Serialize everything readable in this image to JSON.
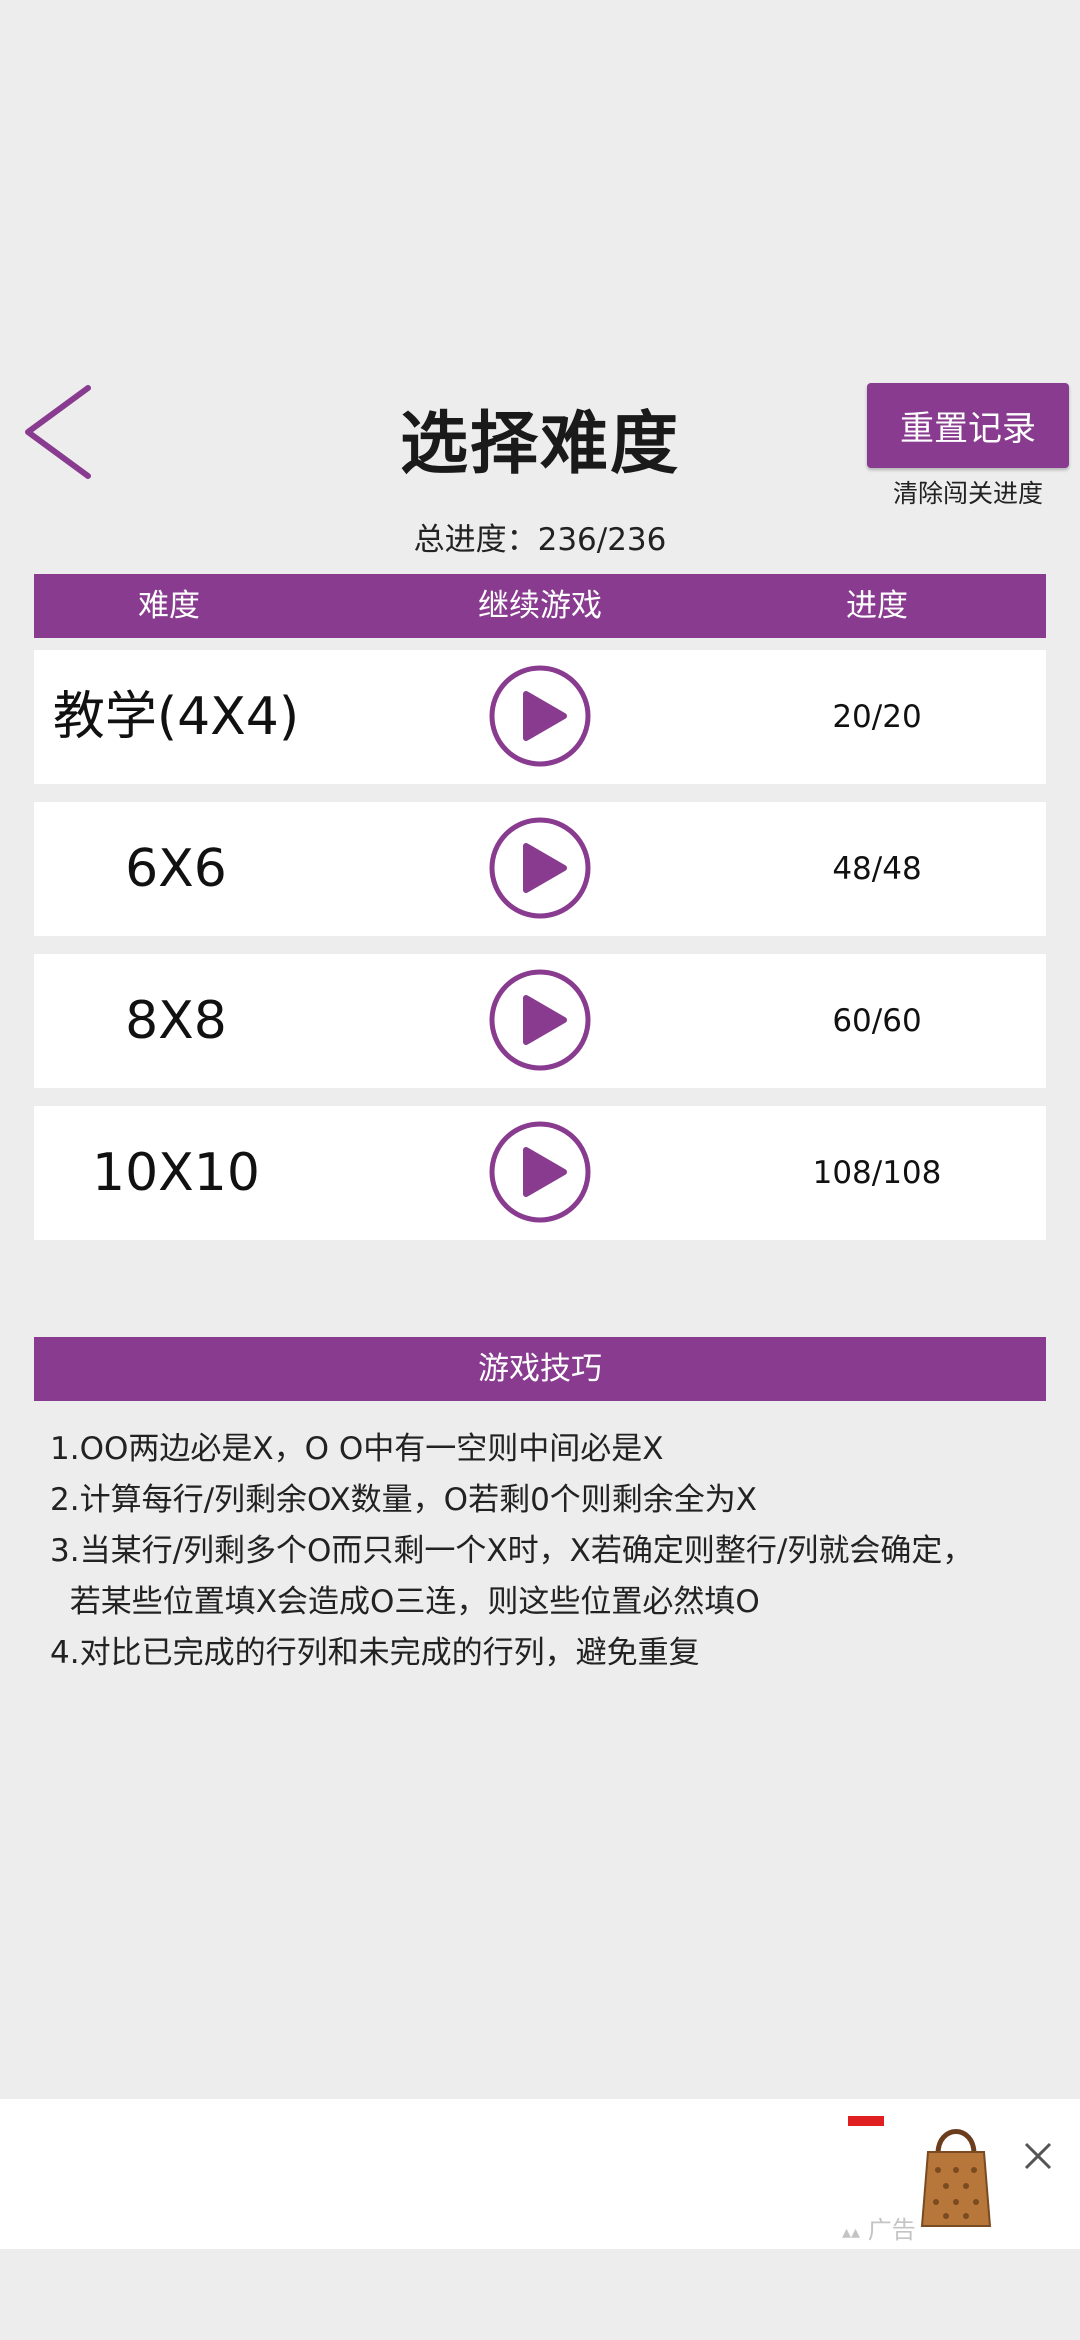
{
  "header": {
    "title": "选择难度",
    "reset_button": "重置记录",
    "reset_hint": "清除闯关进度",
    "total_progress": "总进度：236/236"
  },
  "table": {
    "headers": [
      "难度",
      "继续游戏",
      "进度"
    ],
    "rows": [
      {
        "name": "教学(4X4)",
        "progress": "20/20"
      },
      {
        "name": "6X6",
        "progress": "48/48"
      },
      {
        "name": "8X8",
        "progress": "60/60"
      },
      {
        "name": "10X10",
        "progress": "108/108"
      }
    ]
  },
  "tips": {
    "title": "游戏技巧",
    "items": [
      "1.OO两边必是X，O O中有一空则中间必是X",
      "2.计算每行/列剩余OX数量，O若剩0个则剩余全为X",
      "3.当某行/列剩多个O而只剩一个X时，X若确定则整行/列就会确定，",
      "  若某些位置填X会造成O三连，则这些位置必然填O",
      "4.对比已完成的行列和未完成的行列，避免重复"
    ]
  },
  "ad": {
    "label": "广告"
  },
  "colors": {
    "accent": "#883b8f",
    "background": "#ededed"
  },
  "icons": {
    "back": "chevron-left-icon",
    "play": "play-circle-icon",
    "close": "close-icon"
  }
}
